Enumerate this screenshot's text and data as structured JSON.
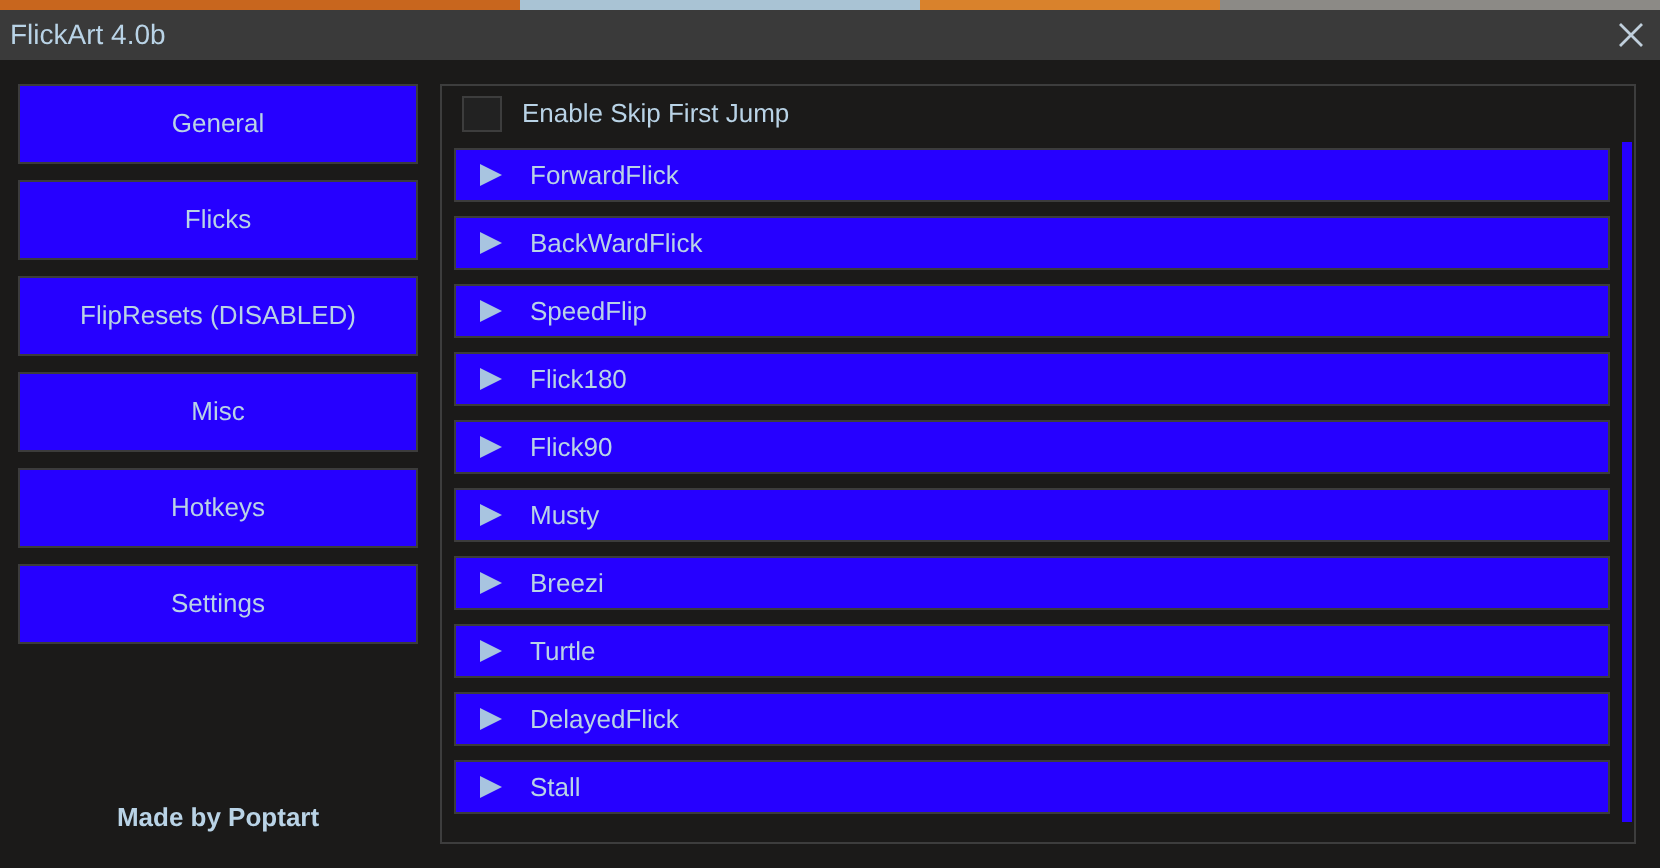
{
  "window": {
    "title": "FlickArt 4.0b"
  },
  "sidebar": {
    "items": [
      {
        "label": "General",
        "selected": false
      },
      {
        "label": "Flicks",
        "selected": false
      },
      {
        "label": "FlipResets (DISABLED)",
        "selected": false
      },
      {
        "label": "Misc",
        "selected": false
      },
      {
        "label": "Hotkeys",
        "selected": false
      },
      {
        "label": "Settings",
        "selected": false
      }
    ],
    "footer": "Made by Poptart"
  },
  "content": {
    "checkbox": {
      "label": "Enable Skip First Jump",
      "checked": false
    },
    "sections": [
      {
        "label": "ForwardFlick",
        "expanded": false
      },
      {
        "label": "BackWardFlick",
        "expanded": false
      },
      {
        "label": "SpeedFlip",
        "expanded": false
      },
      {
        "label": "Flick180",
        "expanded": false
      },
      {
        "label": "Flick90",
        "expanded": false
      },
      {
        "label": "Musty",
        "expanded": false
      },
      {
        "label": "Breezi",
        "expanded": false
      },
      {
        "label": "Turtle",
        "expanded": false
      },
      {
        "label": "DelayedFlick",
        "expanded": false
      },
      {
        "label": "Stall",
        "expanded": false
      }
    ]
  }
}
